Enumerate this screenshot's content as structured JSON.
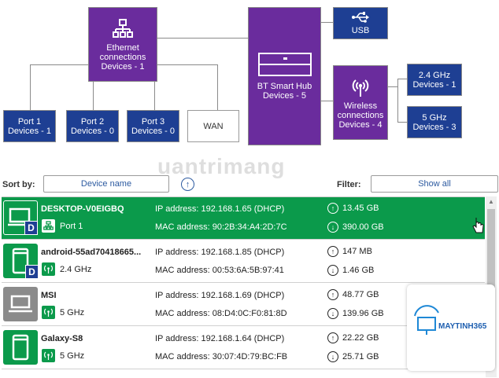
{
  "diagram": {
    "ethernet": {
      "line1": "Ethernet",
      "line2": "connections",
      "devices": "Devices - 1"
    },
    "hub": {
      "title": "BT Smart Hub",
      "devices": "Devices - 5"
    },
    "usb": {
      "label": "USB"
    },
    "ports": [
      {
        "name": "Port 1",
        "devices": "Devices - 1"
      },
      {
        "name": "Port 2",
        "devices": "Devices - 0"
      },
      {
        "name": "Port 3",
        "devices": "Devices - 0"
      }
    ],
    "wan": {
      "label": "WAN"
    },
    "wireless": {
      "line1": "Wireless",
      "line2": "connections",
      "devices": "Devices - 4"
    },
    "band24": {
      "name": "2.4 GHz",
      "devices": "Devices - 1"
    },
    "band5": {
      "name": "5 GHz",
      "devices": "Devices - 3"
    }
  },
  "toolbar": {
    "sort_label": "Sort by:",
    "sort_value": "Device name",
    "filter_label": "Filter:",
    "filter_value": "Show all"
  },
  "devices": [
    {
      "name": "DESKTOP-V0EIGBQ",
      "connection": "Port 1",
      "conn_type": "ethernet-icon",
      "ip": "IP address: 192.168.1.65 (DHCP)",
      "mac": "MAC address: 90:2B:34:A4:2D:7C",
      "upload": "13.45 GB",
      "download": "390.00 GB",
      "device_type": "desktop-icon",
      "selected": true
    },
    {
      "name": "android-55ad70418665...",
      "connection": "2.4 GHz",
      "conn_type": "wifi-icon",
      "ip": "IP address: 192.168.1.85 (DHCP)",
      "mac": "MAC address: 00:53:6A:5B:97:41",
      "upload": "147 MB",
      "download": "1.46 GB",
      "device_type": "phone-icon",
      "selected": false
    },
    {
      "name": "MSI",
      "connection": "5 GHz",
      "conn_type": "wifi-icon",
      "ip": "IP address: 192.168.1.69 (DHCP)",
      "mac": "MAC address: 08:D4:0C:F0:81:8D",
      "upload": "48.77 GB",
      "download": "139.96 GB",
      "device_type": "laptop-icon",
      "selected": false
    },
    {
      "name": "Galaxy-S8",
      "connection": "5 GHz",
      "conn_type": "wifi-icon",
      "ip": "IP address: 192.168.1.64 (DHCP)",
      "mac": "MAC address: 30:07:4D:79:BC:FB",
      "upload": "22.22 GB",
      "download": "25.71 GB",
      "device_type": "phone-icon",
      "selected": false
    }
  ],
  "watermark": {
    "text": "uantrimang",
    "logo": "MAYTINH365"
  },
  "colors": {
    "purple": "#6a2c9d",
    "blue": "#1e3f93",
    "green": "#0b9a4b",
    "grey": "#8b8b8b"
  }
}
